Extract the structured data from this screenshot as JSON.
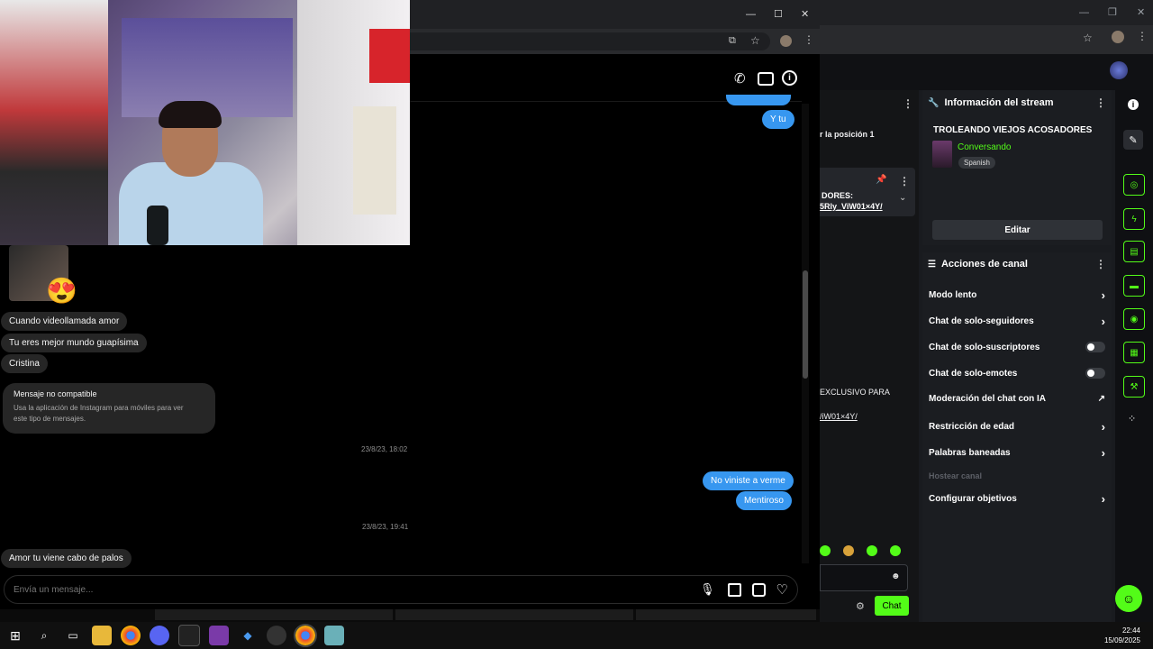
{
  "dashboard": {
    "chat_fragments": {
      "position": "r la posición 1",
      "pinned_label": "DORES:",
      "pinned_link": "5Rly_ViW01×4Y/",
      "exclusive": "EXCLUSIVO PARA",
      "link2": "/iW01×4Y/"
    },
    "chat_button": "Chat",
    "stream_info": {
      "header": "Información del stream",
      "title": "TROLEANDO VIEJOS ACOSADORES",
      "category": "Conversando",
      "language": "Spanish",
      "edit_button": "Editar"
    },
    "channel_actions": {
      "header": "Acciones de canal",
      "items": [
        {
          "label": "Modo lento",
          "control": "chevron"
        },
        {
          "label": "Chat de solo-seguidores",
          "control": "chevron"
        },
        {
          "label": "Chat de solo-suscriptores",
          "control": "toggle"
        },
        {
          "label": "Chat de solo-emotes",
          "control": "toggle"
        },
        {
          "label": "Moderación del chat con IA",
          "control": "external"
        },
        {
          "label": "Restricción de edad",
          "control": "chevron"
        },
        {
          "label": "Palabras baneadas",
          "control": "chevron"
        }
      ],
      "disabled_item": "Hostear canal",
      "last_item": "Configurar objetivos"
    },
    "accent_color": "#53fc18"
  },
  "instagram": {
    "messages_top_out": [
      "Y tu"
    ],
    "messages_in": [
      "Cuando videollamada amor",
      "Tu eres mejor mundo guapísima",
      "Cristina"
    ],
    "unsupported": {
      "title": "Mensaje no compatible",
      "body": "Usa la aplicación de Instagram para móviles para ver este tipo de mensajes."
    },
    "timestamp1": "23/8/23, 18:02",
    "messages_out": [
      "No viniste a verme",
      "Mentiroso"
    ],
    "timestamp2": "23/8/23, 19:41",
    "last_in": "Amor tu viene cabo de palos",
    "input_placeholder": "Envía un mensaje...",
    "bubble_out_color": "#3797f0"
  },
  "taskbar": {
    "time": "22:44",
    "date": "15/09/2025"
  }
}
